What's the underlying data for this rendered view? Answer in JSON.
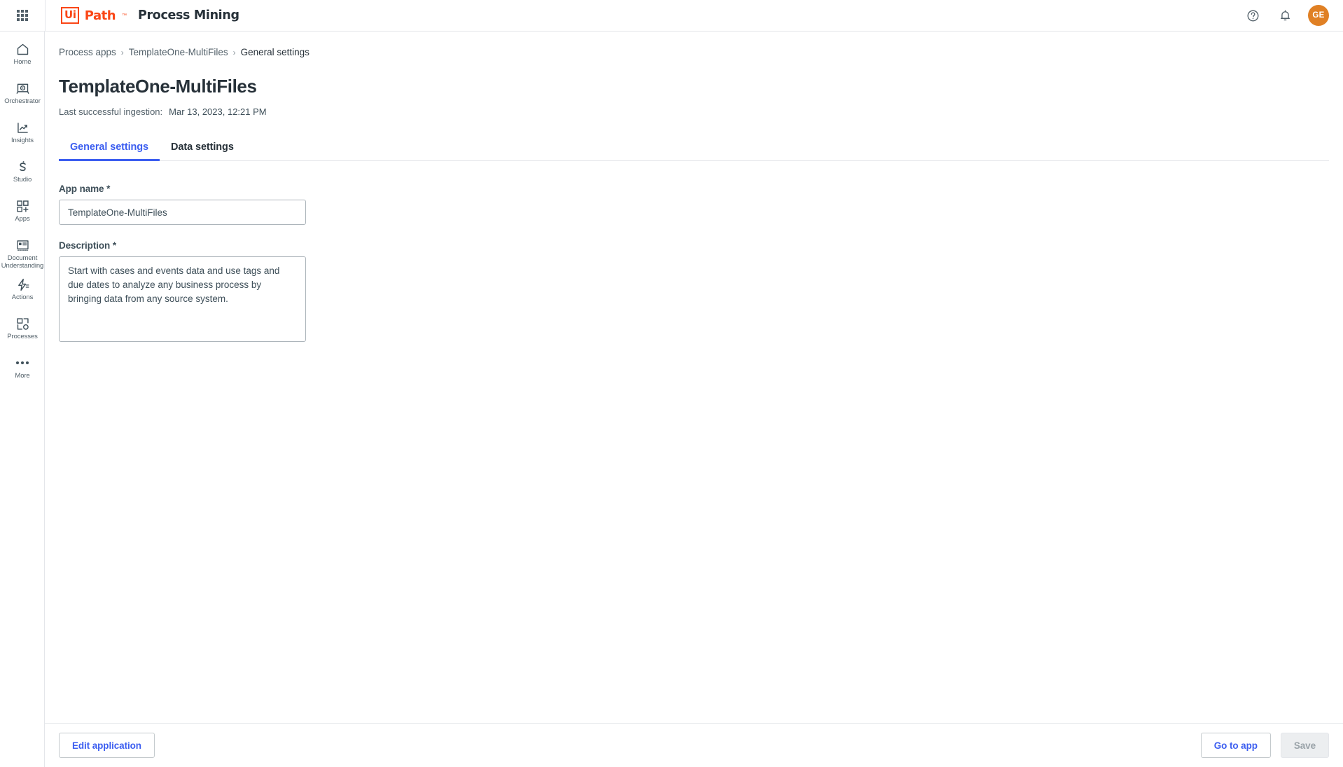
{
  "topbar": {
    "app_grid_icon": "grid-apps-icon",
    "logo": {
      "mark_ui": "Ui",
      "mark_path": "Path",
      "tm": "™"
    },
    "product": "Process Mining",
    "help_icon": "help-circle-icon",
    "notifications_icon": "bell-icon",
    "avatar_initials": "GE",
    "avatar_color": "#e08024"
  },
  "sidebar": {
    "items": [
      {
        "label": "Home",
        "icon": "home-icon"
      },
      {
        "label": "Orchestrator",
        "icon": "orchestrator-icon"
      },
      {
        "label": "Insights",
        "icon": "insights-chart-icon"
      },
      {
        "label": "Studio",
        "icon": "studio-icon"
      },
      {
        "label": "Apps",
        "icon": "apps-grid-plus-icon"
      },
      {
        "label": "Document Understanding",
        "icon": "document-understanding-icon"
      },
      {
        "label": "Actions",
        "icon": "actions-bolt-icon"
      },
      {
        "label": "Processes",
        "icon": "processes-icon"
      },
      {
        "label": "More",
        "icon": "more-dots-icon"
      }
    ]
  },
  "breadcrumb": {
    "items": [
      "Process apps",
      "TemplateOne-MultiFiles",
      "General settings"
    ],
    "separator": "›"
  },
  "page": {
    "title": "TemplateOne-MultiFiles",
    "ingestion_label": "Last successful ingestion:",
    "ingestion_value": "Mar 13, 2023, 12:21 PM"
  },
  "tabs": [
    {
      "label": "General settings",
      "active": true
    },
    {
      "label": "Data settings",
      "active": false
    }
  ],
  "form": {
    "app_name": {
      "label": "App name *",
      "value": "TemplateOne-MultiFiles",
      "placeholder": "App name"
    },
    "description": {
      "label": "Description *",
      "value": "Start with cases and events data and use tags and due dates to analyze any business process by bringing data from any source system.",
      "placeholder": "Description"
    }
  },
  "footer": {
    "edit_application": "Edit application",
    "go_to_app": "Go to app",
    "save": "Save"
  },
  "colors": {
    "accent_blue": "#3c5ef0",
    "brand_orange": "#fa4616",
    "text_dark": "#273139",
    "text_muted": "#526069",
    "border": "#e4e6ea"
  }
}
